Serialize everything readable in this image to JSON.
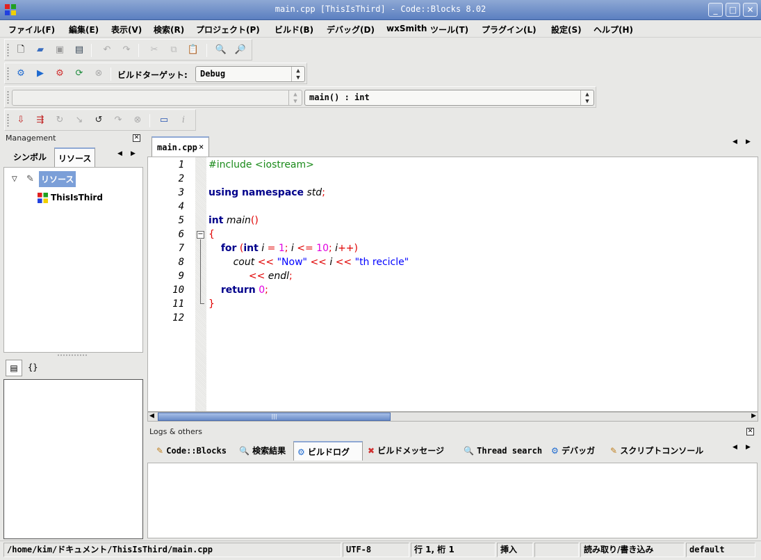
{
  "window": {
    "title": "main.cpp [ThisIsThird] - Code::Blocks 8.02",
    "minimize": "_",
    "maximize": "□",
    "close": "✕"
  },
  "menu": [
    "ファイル(F)",
    "編集(E)",
    "表示(V)",
    "検索(R)",
    "プロジェクト(P)",
    "ビルド(B)",
    "デバッグ(D)",
    "wxSmith",
    "ツール(T)",
    "プラグイン(L)",
    "設定(S)",
    "ヘルプ(H)"
  ],
  "build_toolbar": {
    "target_label": "ビルドターゲット:",
    "target_value": "Debug"
  },
  "codecompletion": {
    "scope_value": "",
    "function_value": "main() : int"
  },
  "management": {
    "caption": "Management",
    "tabs": [
      "シンボル",
      "リソース"
    ],
    "tree_root": "リソース",
    "tree_child": "ThisIsThird",
    "bottom_tab2": "{}"
  },
  "editor": {
    "tab_label": "main.cpp",
    "tab_close": "×",
    "line_numbers": [
      "1",
      "2",
      "3",
      "4",
      "5",
      "6",
      "7",
      "8",
      "9",
      "10",
      "11",
      "12"
    ]
  },
  "logs": {
    "caption": "Logs & others",
    "tabs": [
      "Code::Blocks",
      "検索結果",
      "ビルドログ",
      "ビルドメッセージ",
      "Thread search",
      "デバッガ",
      "スクリプトコンソール"
    ]
  },
  "statusbar": {
    "path": "/home/kim/ドキュメント/ThisIsThird/main.cpp",
    "encoding": "UTF-8",
    "position": "行 1, 桁 1",
    "mode": "挿入",
    "blank": "",
    "access": "読み取り/書き込み",
    "profile": "default"
  }
}
